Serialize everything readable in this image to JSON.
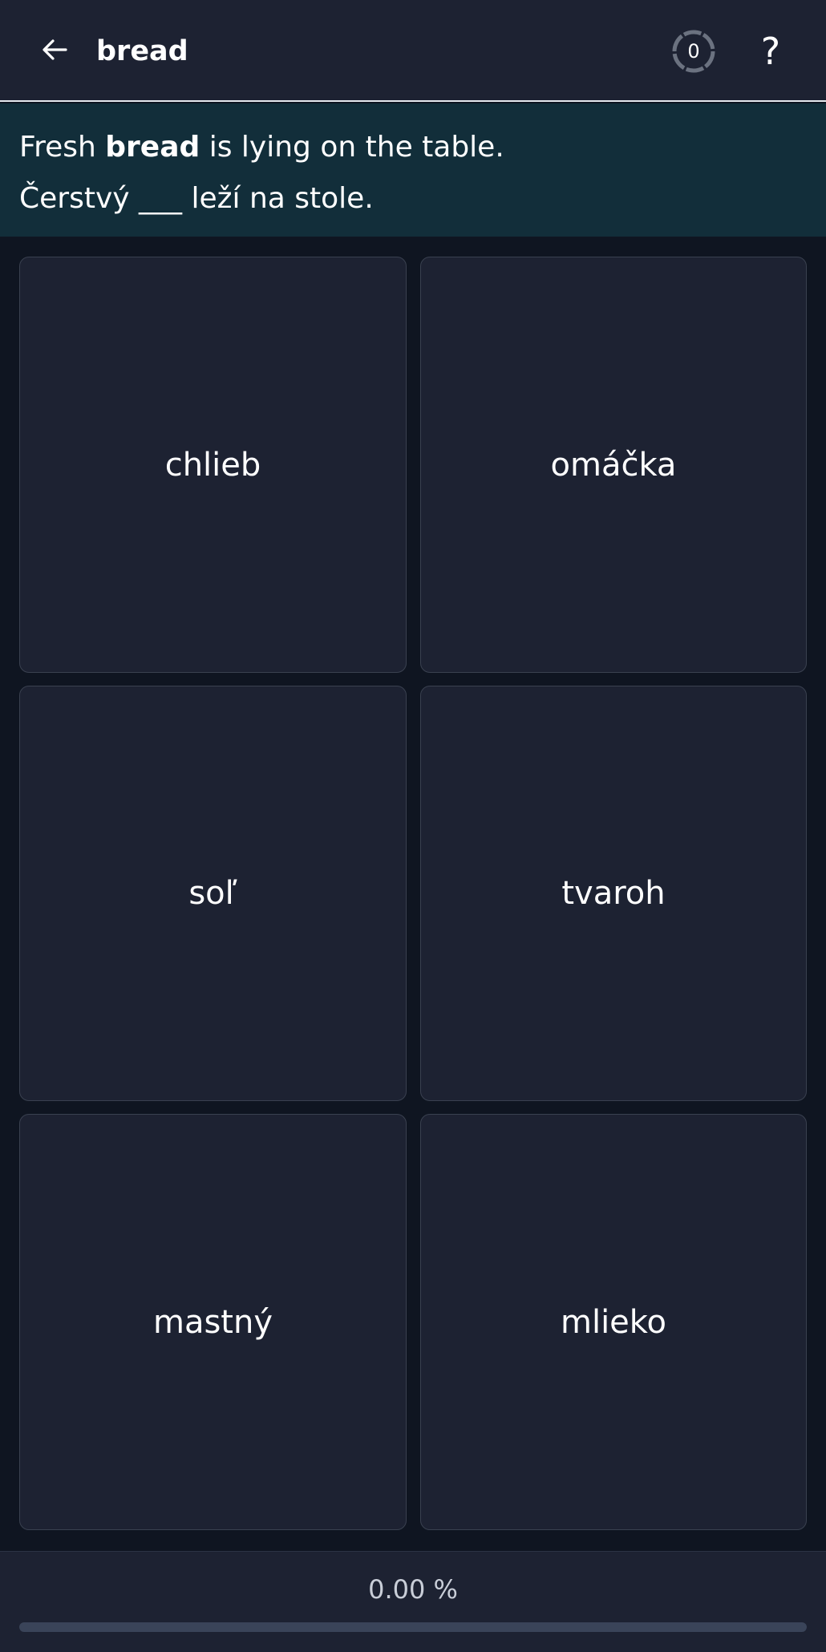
{
  "header": {
    "title": "bread",
    "counter_value": "0",
    "help_label": "?"
  },
  "prompt": {
    "english_before": "Fresh ",
    "english_keyword": "bread",
    "english_after": " is lying on the table.",
    "translation": "Čerstvý ___ leží na stole."
  },
  "options": [
    {
      "label": "chlieb"
    },
    {
      "label": "omáčka"
    },
    {
      "label": "soľ"
    },
    {
      "label": "tvaroh"
    },
    {
      "label": "mastný"
    },
    {
      "label": "mlieko"
    }
  ],
  "progress": {
    "label": "0.00 %",
    "fraction": 0.0
  },
  "icons": {
    "back": "arrow-left-icon",
    "counter": "circular-timer-icon"
  }
}
